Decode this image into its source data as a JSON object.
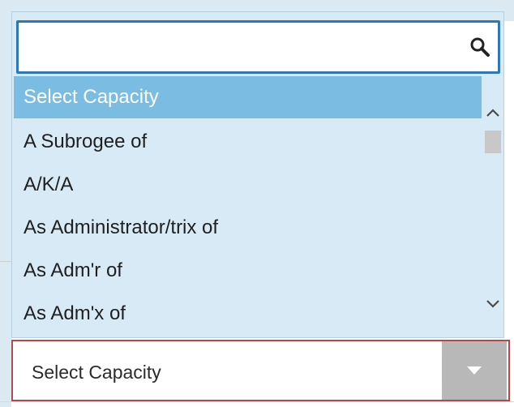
{
  "search": {
    "value": "",
    "placeholder": "",
    "icon": "search-icon"
  },
  "options": [
    {
      "label": "Select Capacity",
      "selected": true
    },
    {
      "label": "A Subrogee of",
      "selected": false
    },
    {
      "label": "A/K/A",
      "selected": false
    },
    {
      "label": "As Administrator/trix of",
      "selected": false
    },
    {
      "label": "As Adm'r of",
      "selected": false
    },
    {
      "label": "As Adm'x of",
      "selected": false
    }
  ],
  "select": {
    "current_value": "Select Capacity",
    "arrow_icon": "caret-down-icon"
  },
  "scrollbar": {
    "up_icon": "chevron-up-icon",
    "down_icon": "chevron-down-icon"
  },
  "colors": {
    "panel_bg": "#d8eaf6",
    "selected_bg": "#7bbde2",
    "search_border": "#2f78b6",
    "select_border": "#b5494a",
    "arrow_button_bg": "#b8b8b8"
  }
}
